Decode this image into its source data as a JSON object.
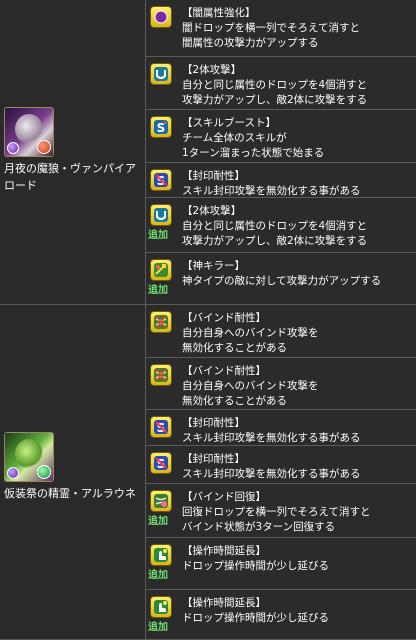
{
  "characters": [
    {
      "name": "月夜の魔狼・ヴァンパイアロード"
    },
    {
      "name": "仮装祭の精霊・アルラウネ"
    }
  ],
  "awakenings": [
    {
      "icon": "dark-orb-enhance-icon",
      "extra": "",
      "lines": [
        "【闇属性強化】",
        "闇ドロップを横一列でそろえて消すと",
        "闇属性の攻撃力がアップする"
      ]
    },
    {
      "icon": "two-pronged-attack-icon",
      "extra": "",
      "lines": [
        "【2体攻撃】",
        "自分と同じ属性のドロップを4個消すと",
        "攻撃力がアップし、敵2体に攻撃をする"
      ]
    },
    {
      "icon": "skill-boost-icon",
      "extra": "",
      "lines": [
        "【スキルブースト】",
        "チーム全体のスキルが",
        "1ターン溜まった状態で始まる"
      ]
    },
    {
      "icon": "skill-bind-resist-icon",
      "extra": "",
      "lines": [
        "【封印耐性】",
        "スキル封印攻撃を無効化する事がある"
      ]
    },
    {
      "icon": "two-pronged-attack-icon",
      "extra": "追加",
      "lines": [
        "【2体攻撃】",
        "自分と同じ属性のドロップを4個消すと",
        "攻撃力がアップし、敵2体に攻撃をする"
      ]
    },
    {
      "icon": "god-killer-icon",
      "extra": "追加",
      "lines": [
        "【神キラー】",
        "神タイプの敵に対して攻撃力がアップする"
      ]
    },
    {
      "icon": "bind-resist-icon",
      "extra": "",
      "lines": [
        "【バインド耐性】",
        "自分自身へのバインド攻撃を",
        "無効化することがある"
      ]
    },
    {
      "icon": "bind-resist-icon",
      "extra": "",
      "lines": [
        "【バインド耐性】",
        "自分自身へのバインド攻撃を",
        "無効化することがある"
      ]
    },
    {
      "icon": "skill-bind-resist-icon",
      "extra": "",
      "lines": [
        "【封印耐性】",
        "スキル封印攻撃を無効化する事がある"
      ]
    },
    {
      "icon": "skill-bind-resist-icon",
      "extra": "",
      "lines": [
        "【封印耐性】",
        "スキル封印攻撃を無効化する事がある"
      ]
    },
    {
      "icon": "bind-recovery-icon",
      "extra": "追加",
      "lines": [
        "【バインド回復】",
        "回復ドロップを横一列でそろえて消すと",
        "バインド状態が3ターン回復する"
      ]
    },
    {
      "icon": "time-extend-icon",
      "extra": "追加",
      "lines": [
        "【操作時間延長】",
        "ドロップ操作時間が少し延びる"
      ]
    },
    {
      "icon": "time-extend-icon",
      "extra": "追加",
      "lines": [
        "【操作時間延長】",
        "ドロップ操作時間が少し延びる"
      ]
    }
  ]
}
